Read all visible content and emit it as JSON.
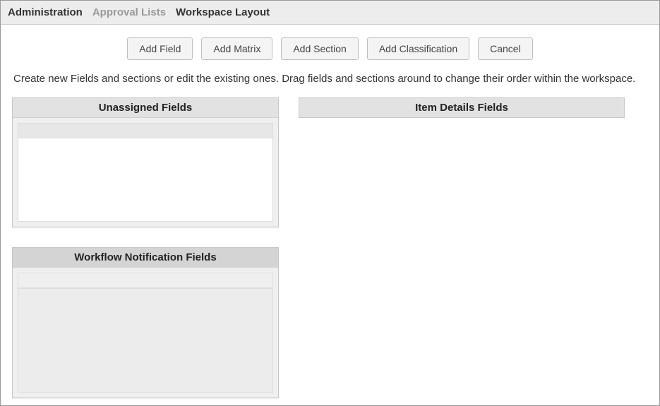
{
  "breadcrumb": {
    "administration": "Administration",
    "approval_lists": "Approval Lists",
    "workspace_layout": "Workspace Layout"
  },
  "toolbar": {
    "add_field": "Add Field",
    "add_matrix": "Add Matrix",
    "add_section": "Add Section",
    "add_classification": "Add Classification",
    "cancel": "Cancel"
  },
  "instruction_text": "Create new Fields and sections or edit the existing ones. Drag fields and sections around to change their order within the workspace.",
  "panels": {
    "unassigned": "Unassigned Fields",
    "workflow_notification": "Workflow Notification Fields",
    "item_details": "Item Details Fields"
  }
}
